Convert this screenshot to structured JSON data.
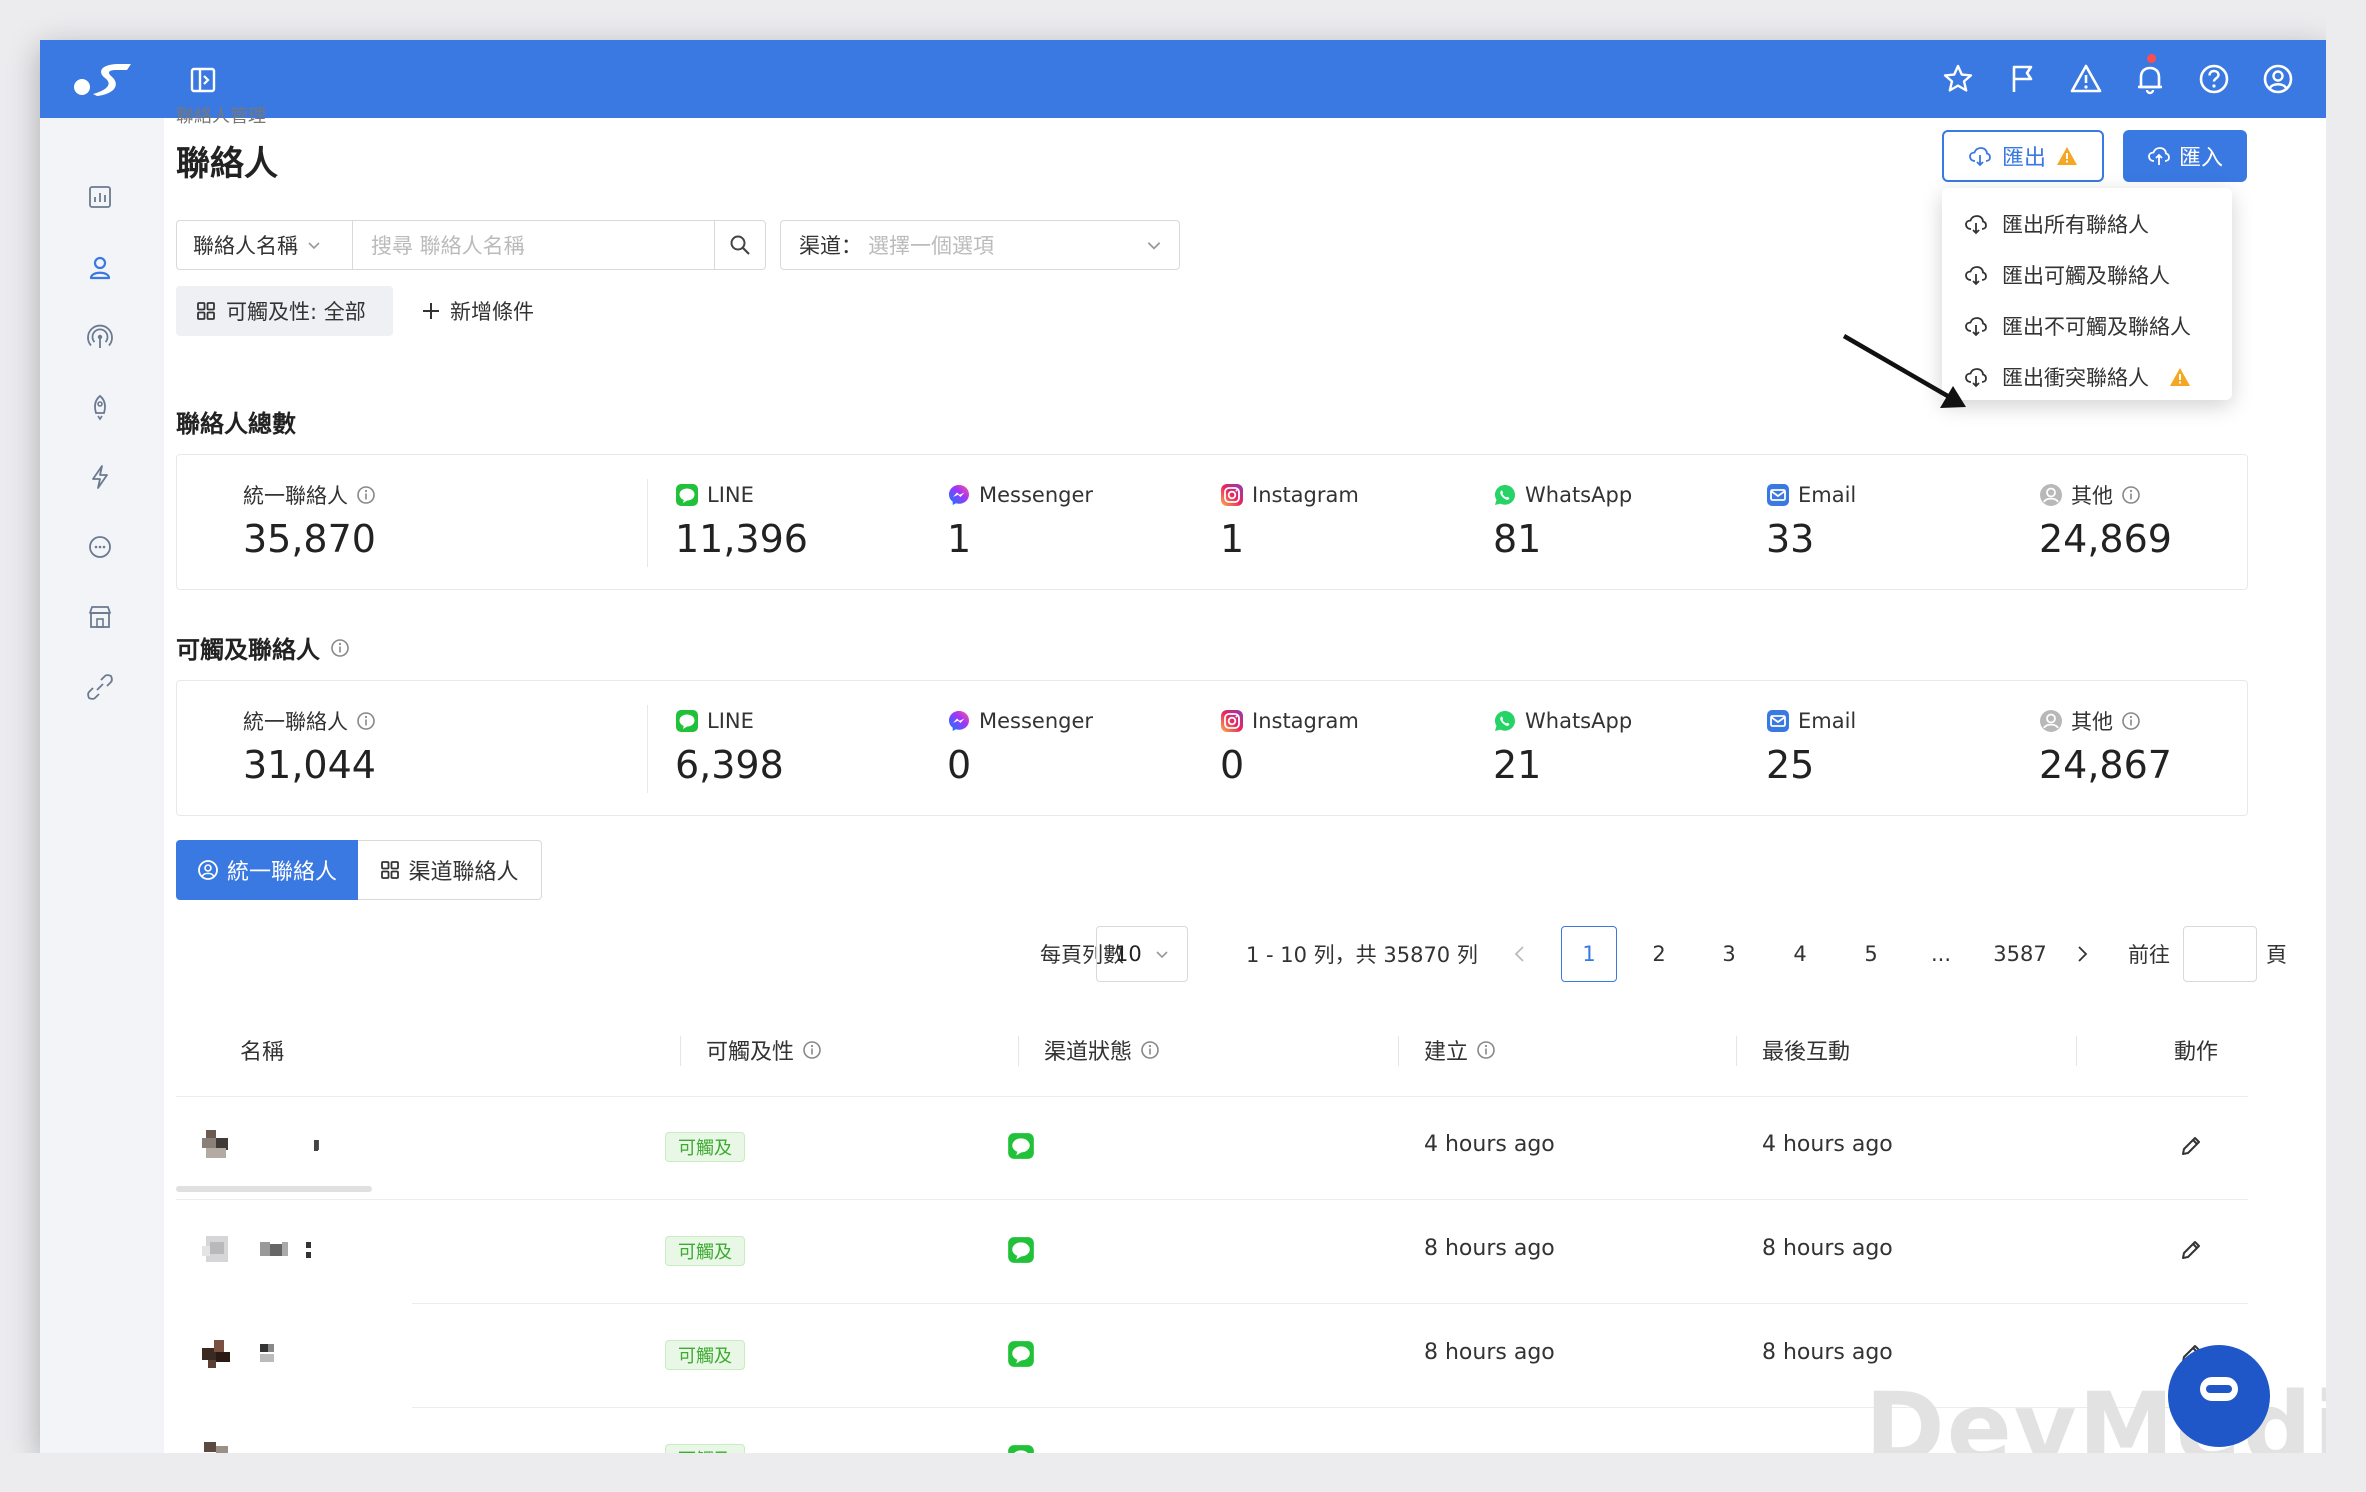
{
  "colors": {
    "primary": "#3a78e2",
    "warning": "#f5a623",
    "success": "#3cab30"
  },
  "breadcrumb": "聯絡人管理",
  "page_title": "聯絡人",
  "toolbar": {
    "export_label": "匯出",
    "import_label": "匯入"
  },
  "export_menu": [
    {
      "label": "匯出所有聯絡人",
      "warning": false
    },
    {
      "label": "匯出可觸及聯絡人",
      "warning": false
    },
    {
      "label": "匯出不可觸及聯絡人",
      "warning": false
    },
    {
      "label": "匯出衝突聯絡人",
      "warning": true
    }
  ],
  "filter": {
    "field_label": "聯絡人名稱",
    "search_placeholder": "搜尋 聯絡人名稱",
    "channel_prefix": "渠道：",
    "channel_placeholder": "選擇一個選項",
    "reach_chip": "可觸及性: 全部",
    "add_condition": "新增條件"
  },
  "total": {
    "title": "聯絡人總數",
    "stats": [
      {
        "label": "統一聯絡人",
        "value": "35,870",
        "icon": "info-icon"
      },
      {
        "label": "LINE",
        "value": "11,396",
        "icon": "line-icon"
      },
      {
        "label": "Messenger",
        "value": "1",
        "icon": "messenger-icon"
      },
      {
        "label": "Instagram",
        "value": "1",
        "icon": "instagram-icon"
      },
      {
        "label": "WhatsApp",
        "value": "81",
        "icon": "whatsapp-icon"
      },
      {
        "label": "Email",
        "value": "33",
        "icon": "email-icon"
      },
      {
        "label": "其他",
        "value": "24,869",
        "icon": "user-icon"
      }
    ]
  },
  "reachable": {
    "title": "可觸及聯絡人",
    "stats": [
      {
        "label": "統一聯絡人",
        "value": "31,044"
      },
      {
        "label": "LINE",
        "value": "6,398"
      },
      {
        "label": "Messenger",
        "value": "0"
      },
      {
        "label": "Instagram",
        "value": "0"
      },
      {
        "label": "WhatsApp",
        "value": "21"
      },
      {
        "label": "Email",
        "value": "25"
      },
      {
        "label": "其他",
        "value": "24,867"
      }
    ]
  },
  "tabs": {
    "unified": "統一聯絡人",
    "channel": "渠道聯絡人"
  },
  "pagination": {
    "per_page_label": "每頁列數",
    "per_page": "10",
    "range": "1 - 10 列，共 35870 列",
    "pages": [
      "1",
      "2",
      "3",
      "4",
      "5",
      "...",
      "3587"
    ],
    "current": "1",
    "goto_label": "前往",
    "page_suffix": "頁"
  },
  "table": {
    "columns": [
      "名稱",
      "可觸及性",
      "渠道狀態",
      "建立",
      "最後互動",
      "動作"
    ],
    "rows": [
      {
        "reach": "可觸及",
        "channel": "line-icon",
        "created": "4 hours ago",
        "last": "4 hours ago"
      },
      {
        "reach": "可觸及",
        "channel": "line-icon",
        "created": "8 hours ago",
        "last": "8 hours ago"
      },
      {
        "reach": "可觸及",
        "channel": "line-icon",
        "created": "8 hours ago",
        "last": "8 hours ago"
      },
      {
        "reach": "可觸及",
        "channel": "line-icon",
        "created": "",
        "last": ""
      }
    ]
  },
  "watermark": "DevMedia"
}
